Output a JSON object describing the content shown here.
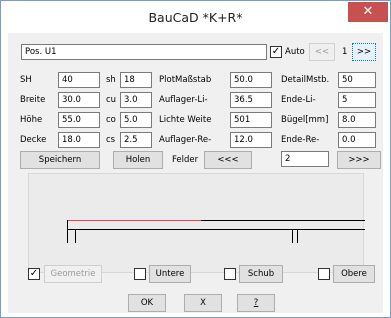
{
  "window": {
    "title": "BauCaD *K+R*",
    "close_glyph": "✕"
  },
  "header": {
    "pos_value": "Pos. U1",
    "auto_label": "Auto",
    "auto_checked": true,
    "prev_label": "<<",
    "page_number": "1",
    "next_label": ">>"
  },
  "col1": {
    "rows": [
      {
        "label": "SH",
        "value": "40"
      },
      {
        "label": "Breite",
        "value": "30.0"
      },
      {
        "label": "Höhe",
        "value": "55.0"
      },
      {
        "label": "Decke",
        "value": "18.0"
      }
    ]
  },
  "col2": {
    "rows": [
      {
        "label": "sh",
        "value": "18"
      },
      {
        "label": "cu",
        "value": "3.0"
      },
      {
        "label": "co",
        "value": "5.0"
      },
      {
        "label": "cs",
        "value": "2.5"
      }
    ]
  },
  "col3": {
    "rows": [
      {
        "label": "PlotMaßstab",
        "value": "50.0"
      },
      {
        "label": "Auflager-Li-",
        "value": "36.5"
      },
      {
        "label": "Lichte Weite",
        "value": "501"
      },
      {
        "label": "Auflager-Re-",
        "value": "12.0"
      }
    ]
  },
  "col4": {
    "rows": [
      {
        "label": "DetailMstb.",
        "value": "50"
      },
      {
        "label": "Ende-Li-",
        "value": "5"
      },
      {
        "label": "Bügel[mm]",
        "value": "8.0"
      },
      {
        "label": "Ende-Re-",
        "value": "0.0"
      }
    ]
  },
  "actions": {
    "save_label": "Speichern",
    "load_label": "Holen",
    "fields_label": "Felder",
    "fields_prev_label": "<<<",
    "fields_value": "2",
    "fields_next_label": ">>>"
  },
  "options": [
    {
      "label": "Geometrie",
      "checked": true,
      "disabled": true
    },
    {
      "label": "Untere",
      "checked": false
    },
    {
      "label": "Schub",
      "checked": false
    },
    {
      "label": "Obere",
      "checked": false
    }
  ],
  "footer": {
    "ok_label": "OK",
    "x_label": "X",
    "help_label": "?"
  },
  "colors": {
    "beam_top_line": "#e44",
    "close_button": "#c75050",
    "accent_border": "#7a9cc9"
  }
}
